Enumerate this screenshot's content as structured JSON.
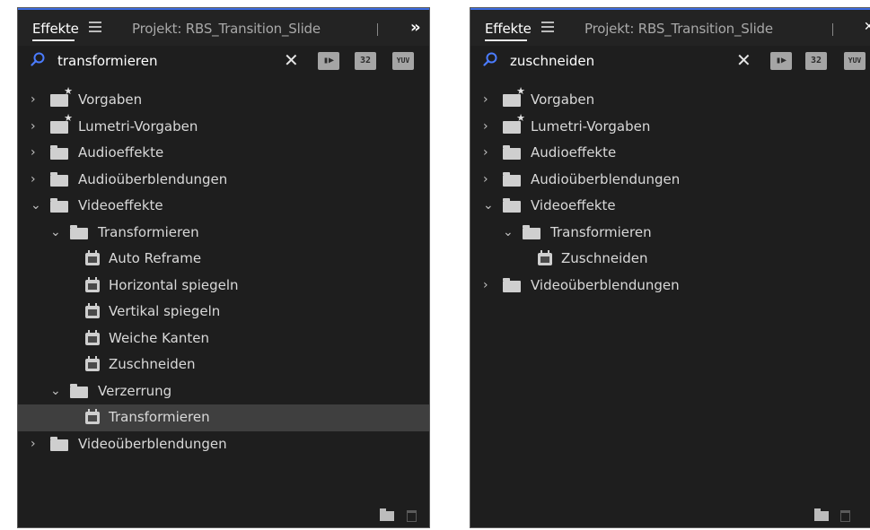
{
  "left_panel": {
    "tab_active": "Effekte",
    "tab_inactive": "Projekt: RBS_Transition_Slide",
    "overflow": "»",
    "search_value": "transformieren",
    "clear": "✕",
    "buttons": {
      "accelerated": "",
      "bit32": "32",
      "yuv": "YUV"
    },
    "tree": [
      {
        "label": "Vorgaben",
        "icon": "preset-folder-icon",
        "chevron": "›"
      },
      {
        "label": "Lumetri-Vorgaben",
        "icon": "preset-folder-icon",
        "chevron": "›"
      },
      {
        "label": "Audioeffekte",
        "icon": "folder-icon",
        "chevron": "›"
      },
      {
        "label": "Audioüberblendungen",
        "icon": "folder-icon",
        "chevron": "›"
      },
      {
        "label": "Videoeffekte",
        "icon": "folder-icon",
        "chevron": "⌄"
      },
      {
        "label": "Transformieren",
        "icon": "folder-icon",
        "chevron": "⌄"
      },
      {
        "label": "Auto Reframe",
        "icon": "effect-icon"
      },
      {
        "label": "Horizontal spiegeln",
        "icon": "effect-icon"
      },
      {
        "label": "Vertikal spiegeln",
        "icon": "effect-icon"
      },
      {
        "label": "Weiche Kanten",
        "icon": "effect-icon"
      },
      {
        "label": "Zuschneiden",
        "icon": "effect-icon"
      },
      {
        "label": "Verzerrung",
        "icon": "folder-icon",
        "chevron": "⌄"
      },
      {
        "label": "Transformieren",
        "icon": "effect-icon",
        "selected": true
      },
      {
        "label": "Videoüberblendungen",
        "icon": "folder-icon",
        "chevron": "›"
      }
    ]
  },
  "right_panel": {
    "tab_active": "Effekte",
    "tab_inactive": "Projekt: RBS_Transition_Slide",
    "search_value": "zuschneiden",
    "clear": "✕",
    "buttons": {
      "accelerated": "",
      "bit32": "32",
      "yuv": "YUV"
    },
    "tree": [
      {
        "label": "Vorgaben",
        "icon": "preset-folder-icon",
        "chevron": "›"
      },
      {
        "label": "Lumetri-Vorgaben",
        "icon": "preset-folder-icon",
        "chevron": "›"
      },
      {
        "label": "Audioeffekte",
        "icon": "folder-icon",
        "chevron": "›"
      },
      {
        "label": "Audioüberblendungen",
        "icon": "folder-icon",
        "chevron": "›"
      },
      {
        "label": "Videoeffekte",
        "icon": "folder-icon",
        "chevron": "⌄"
      },
      {
        "label": "Transformieren",
        "icon": "folder-icon",
        "chevron": "⌄"
      },
      {
        "label": "Zuschneiden",
        "icon": "effect-icon"
      },
      {
        "label": "Videoüberblendungen",
        "icon": "folder-icon",
        "chevron": "›"
      }
    ]
  }
}
